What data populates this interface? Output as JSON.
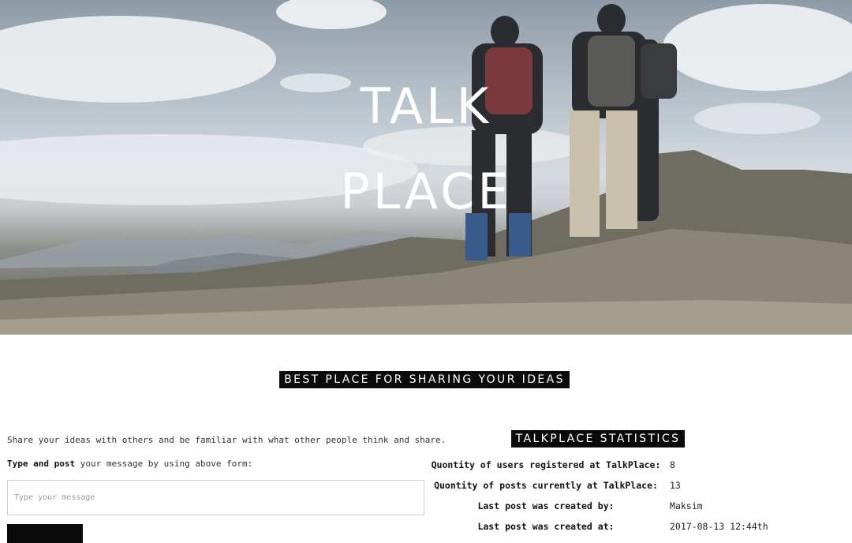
{
  "hero": {
    "title_line1": "TALK",
    "title_line2": "PLACE"
  },
  "tagline": "BEST PLACE FOR SHARING YOUR IDEAS",
  "intro_text": "Share your ideas with others and be familiar with what other people think and share.",
  "post_hint": {
    "bold": "Type and post",
    "rest": " your message by using above form:"
  },
  "message_input": {
    "placeholder": "Type your message",
    "value": ""
  },
  "post_button_label": "",
  "stats": {
    "title": "TALKPLACE STATISTICS",
    "rows": [
      {
        "label": "Quontity of users registered at TalkPlace:",
        "value": "8"
      },
      {
        "label": "Quontity of posts currently at TalkPlace:",
        "value": "13"
      },
      {
        "label": "Last post was created by:",
        "value": "Maksim"
      },
      {
        "label": "Last post was created at:",
        "value": "2017-08-13 12:44th"
      }
    ]
  },
  "colors": {
    "accent_black": "#0b0b0b",
    "background": "#ffffff"
  }
}
